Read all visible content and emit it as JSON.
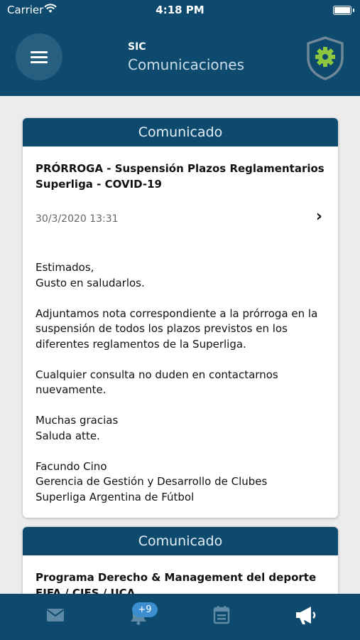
{
  "status_bar": {
    "carrier": "Carrier",
    "time": "4:18 PM"
  },
  "header": {
    "org": "SIC",
    "title": "Comunicaciones"
  },
  "posts": [
    {
      "heading": "Comunicado",
      "title": "PRÓRROGA - Suspensión Plazos Reglamentarios Superliga - COVID-19",
      "date": "30/3/2020 13:31",
      "body": [
        "Estimados,",
        "Gusto en saludarlos.",
        "Adjuntamos nota correspondiente a la prórroga en la suspensión de todos los plazos previstos en los diferentes reglamentos de la Superliga.",
        "Cualquier consulta no duden en contactarnos nuevamente.",
        "Muchas gracias",
        "Saluda atte.",
        "Facundo Cino",
        "Gerencia de Gestión y Desarrollo de Clubes",
        "Superliga Argentina de Fútbol"
      ]
    },
    {
      "heading": "Comunicado",
      "title": "Programa Derecho & Management del deporte FIFA / CIES / UCA"
    }
  ],
  "tabbar": {
    "items": [
      {
        "icon": "mail-icon"
      },
      {
        "icon": "bell-icon",
        "badge": "+9"
      },
      {
        "icon": "calendar-icon"
      },
      {
        "icon": "megaphone-icon",
        "active": true
      }
    ],
    "colors": {
      "inactive": "#5f8aa6",
      "active": "#ffffff",
      "badge": "#3d8ed0"
    }
  },
  "colors": {
    "brand": "#0d4a6e",
    "background": "#ececec",
    "settings_gear": "#8dc63f"
  }
}
